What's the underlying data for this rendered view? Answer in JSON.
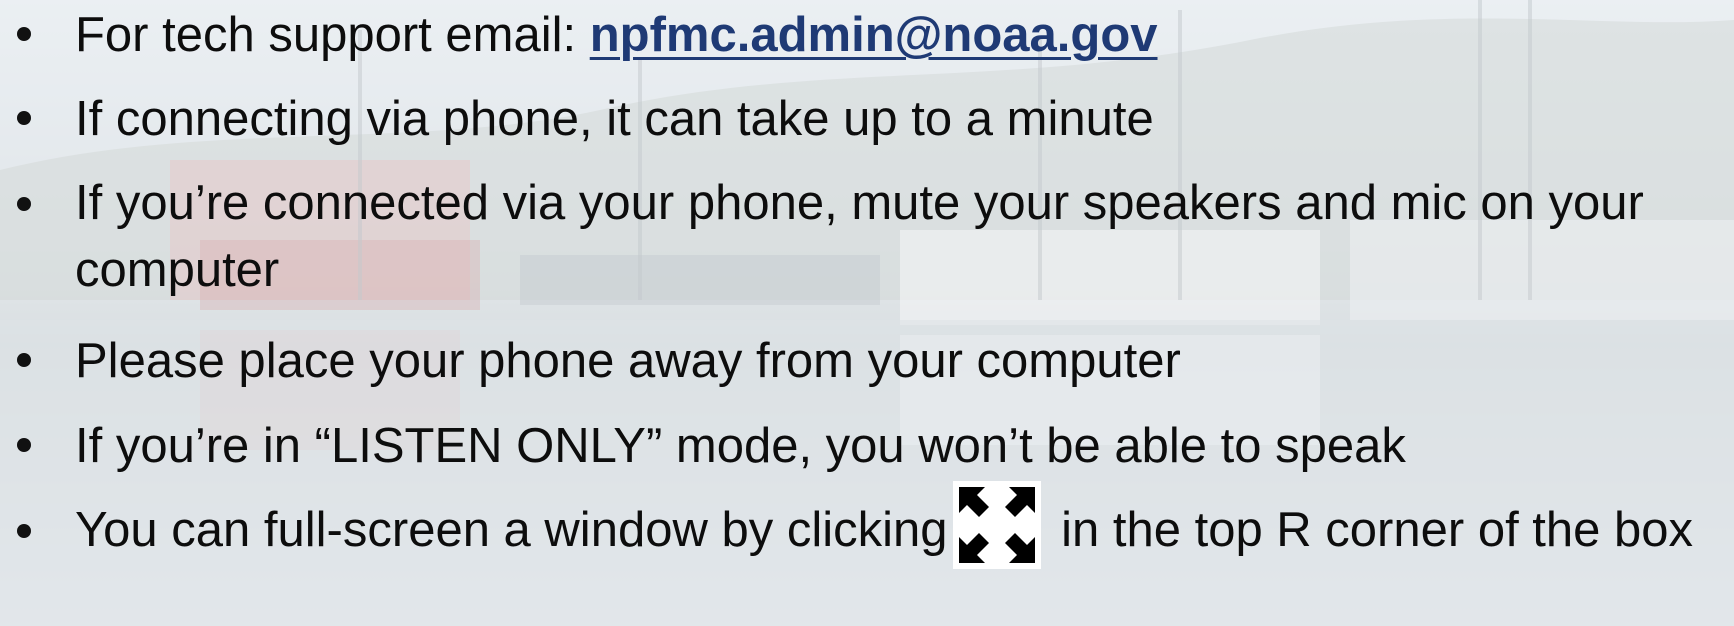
{
  "email_label": "For tech support email: ",
  "email_link": "npfmc.admin@noaa.gov",
  "bullets": {
    "phone_wait": "If connecting via phone, it can take up to a minute",
    "mute": "If you’re connected via your phone, mute your speakers and mic on your computer",
    "phone_away": "Please place your phone away from your computer",
    "listen_only": "If you’re in “LISTEN ONLY” mode, you won’t be able to speak",
    "fullscreen_before": "You can full-screen a window by clicking",
    "fullscreen_after": " in the top R corner of the box"
  },
  "colors": {
    "link": "#1f3a75",
    "text": "#0d0d0d"
  },
  "icons": {
    "fullscreen": "fullscreen-expand-icon"
  }
}
